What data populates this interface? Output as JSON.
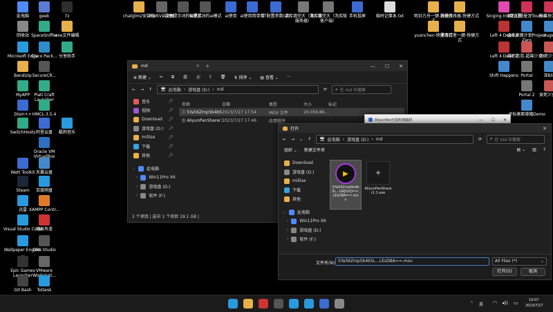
{
  "desktop": {
    "icons": [
      {
        "label": "此电脑",
        "color": "#4f8cff"
      },
      {
        "label": "geek",
        "color": "#5a7bd6"
      },
      {
        "label": "7z",
        "color": "#2e2e2e"
      },
      {
        "label": "chatglm2安装包",
        "color": "#e8b04a"
      },
      {
        "label": "RWKV启动器",
        "color": "#666"
      },
      {
        "label": "没有提示词的ai模式",
        "color": "#555"
      },
      {
        "label": "有提示词的ai模式",
        "color": "#555"
      },
      {
        "label": "ai使用",
        "color": "#3c6bd1"
      },
      {
        "label": "ai使用简单版",
        "color": "#3c6bd1"
      },
      {
        "label": "TT配置参数(ai)",
        "color": "#3c6bd1"
      },
      {
        "label": "清库填完大（洗库版服务器）",
        "color": "#777"
      },
      {
        "label": "清库填完大（洗库版客户端）",
        "color": "#777"
      },
      {
        "label": "手机投屏",
        "color": "#3c6bd1"
      },
      {
        "label": "临时记事本.txt",
        "color": "#ddd"
      },
      {
        "label": "明日方舟一键-快捷方式",
        "color": "#e8b04a"
      },
      {
        "label": "游戏修改器-快捷方式",
        "color": "#e8b04a"
      },
      {
        "label": "Singing Iris魔之歌",
        "color": "#e04ab0"
      },
      {
        "label": "东方幻想曼涅Touhou",
        "color": "#c35"
      },
      {
        "label": "故事扮演模",
        "color": "#c35"
      },
      {
        "label": "回收站",
        "color": "#888"
      },
      {
        "label": "SpaceSniffer",
        "color": "#3a8"
      },
      {
        "label": "exe文件编辑",
        "color": "#e8b04a"
      },
      {
        "label": "yuanchen-快捷方式",
        "color": "#e8b04a"
      },
      {
        "label": "灵魂行者一键-快捷方式",
        "color": "#e8b04a"
      },
      {
        "label": "Left 4 Dead 2",
        "color": "#b33"
      },
      {
        "label": "虚拟桌面计划Project Zero",
        "color": "#48c"
      },
      {
        "label": "mugen",
        "color": "#48c"
      },
      {
        "label": "Microsoft Edge",
        "color": "#2a9adf"
      },
      {
        "label": "Cisco Pack...",
        "color": "#2f8cc8"
      },
      {
        "label": "分享助手",
        "color": "#3a8"
      },
      {
        "label": "Left 4 Dead 2",
        "color": "#b33"
      },
      {
        "label": "踩行恋恋-超兽少女~",
        "color": "#c55"
      },
      {
        "label": "抱死少女2",
        "color": "#c55"
      },
      {
        "label": "Bandizip",
        "color": "#e8b04a"
      },
      {
        "label": "SecureCR...",
        "color": "#555"
      },
      {
        "label": "Shift Happens",
        "color": "#48c"
      },
      {
        "label": "Portal",
        "color": "#777"
      },
      {
        "label": "深Blio",
        "color": "#48c"
      },
      {
        "label": "MyAPP",
        "color": "#3a8"
      },
      {
        "label": "Plati Craft Launcher",
        "color": "#3a8"
      },
      {
        "label": "Portal 2",
        "color": "#777"
      },
      {
        "label": "食死少女乱",
        "color": "#c55"
      },
      {
        "label": "Dism++",
        "color": "#3c6bd1"
      },
      {
        "label": "HMCL-3.5.4",
        "color": "#3a8"
      },
      {
        "label": "虚拟桌面增幅Demo",
        "color": "#48c"
      },
      {
        "label": "SwitchHosts",
        "color": "#3a8"
      },
      {
        "label": "阿里云盘",
        "color": "#3c6bd1"
      },
      {
        "label": "酷狗音乐",
        "color": "#2a9adf"
      },
      {
        "label": "Oracle VM VirtualBox",
        "color": "#2f6fbf"
      },
      {
        "label": "Watt Toolkit",
        "color": "#3c6bd1"
      },
      {
        "label": "天翼云盘",
        "color": "#48c"
      },
      {
        "label": "Steam",
        "color": "#1b2838"
      },
      {
        "label": "百度网盘",
        "color": "#2a9adf"
      },
      {
        "label": "迅雷",
        "color": "#2a9adf"
      },
      {
        "label": "XAMPP Contr...",
        "color": "#e07a2a"
      },
      {
        "label": "Visual Studio Code",
        "color": "#2a9adf"
      },
      {
        "label": "网易有道",
        "color": "#c33"
      },
      {
        "label": "Wallpaper Engine: ...",
        "color": "#2a9adf"
      },
      {
        "label": "OBS Studio",
        "color": "#555"
      },
      {
        "label": "Epic Games Launcher",
        "color": "#333"
      },
      {
        "label": "VMware Workstati...",
        "color": "#666"
      },
      {
        "label": "Git Bash",
        "color": "#444"
      },
      {
        "label": "ToDesk",
        "color": "#2a9adf"
      }
    ]
  },
  "explorer": {
    "title": "md",
    "toolbar": {
      "new": "新建",
      "sort": "排序",
      "view": "查看"
    },
    "breadcrumb": [
      "此电脑",
      "游戏盘 (D:)",
      "md"
    ],
    "search_placeholder": "在 md 中搜索",
    "columns": [
      "名称",
      "日期",
      "类型",
      "大小",
      "标记"
    ],
    "rows": [
      {
        "name": "5Ya56Zmp5b4b5L...",
        "date": "2023/7/27 17:54",
        "type": "MOV 文件",
        "size": "20,059,86..."
      },
      {
        "name": "AliyunPanSharer1...",
        "date": "2023/7/27 17:46",
        "type": "应用程序",
        "size": ""
      }
    ],
    "sidebar": [
      {
        "label": "音乐",
        "color": "#e05a5a"
      },
      {
        "label": "视频",
        "color": "#9b59d0"
      },
      {
        "label": "Download",
        "color": "#e8b04a"
      },
      {
        "label": "游戏盘 (D:)",
        "color": "#888"
      },
      {
        "label": "millise",
        "color": "#e8b04a"
      },
      {
        "label": "下载",
        "color": "#3aa0e0"
      },
      {
        "label": "其他",
        "color": "#e8b04a"
      }
    ],
    "tree": [
      {
        "label": "此电脑",
        "color": "#4f8cff"
      },
      {
        "label": "Win11Pro X6",
        "color": "#4f8cff"
      },
      {
        "label": "游戏盘 (D:)",
        "color": "#888"
      },
      {
        "label": "软件 (F:)",
        "color": "#888"
      }
    ],
    "status": "2 个项目  |  选中 1 个项目  19.1 GB  |"
  },
  "aliyun": {
    "title": "AliyunPan分享秒链解析"
  },
  "open_dialog": {
    "title": "打开",
    "breadcrumb": [
      "此电脑",
      "游戏盘 (D:)",
      "md"
    ],
    "search_placeholder": "在 md 中搜索",
    "organize": "组织",
    "new_folder": "新建文件夹",
    "sidebar": [
      {
        "label": "Download",
        "color": "#e8b04a"
      },
      {
        "label": "游戏盘 (D:)",
        "color": "#888"
      },
      {
        "label": "millise",
        "color": "#e8b04a"
      },
      {
        "label": "下载",
        "color": "#3aa0e0"
      },
      {
        "label": "其他",
        "color": "#e8b04a"
      }
    ],
    "tree": [
      {
        "label": "此电脑",
        "color": "#4f8cff"
      },
      {
        "label": "Win11Pro X6",
        "color": "#4f8cff"
      },
      {
        "label": "游戏盘 (D:)",
        "color": "#888"
      },
      {
        "label": "软件 (F:)",
        "color": "#888"
      }
    ],
    "files": [
      {
        "name": "5Ya56Zmp5b4b5L...LWJVxQ==.LEsDBA==.mov"
      },
      {
        "name": "AliyunPanShare r1.1.exe"
      }
    ],
    "file_name_label": "文件名(N):",
    "file_name_value": "5Ya56Zmp5b4b5L...LEsDBA==.mov",
    "filter": "All Files (*)",
    "open_label": "打开(O)",
    "cancel_label": "取消"
  },
  "taskbar": {
    "icons": [
      {
        "name": "windows-start-icon",
        "color": "#2a9adf"
      },
      {
        "name": "file-explorer-icon",
        "color": "#e8b04a"
      },
      {
        "name": "terminal-icon",
        "color": "#c33"
      },
      {
        "name": "app-icon",
        "color": "#555"
      },
      {
        "name": "steam-icon",
        "color": "#2a9adf"
      },
      {
        "name": "edge-icon",
        "color": "#2a9adf"
      },
      {
        "name": "blue-app-icon",
        "color": "#3c6bd1"
      },
      {
        "name": "settings-icon",
        "color": "#888"
      }
    ],
    "lang": "英",
    "time": "19:07",
    "date": "2023/7/27"
  }
}
